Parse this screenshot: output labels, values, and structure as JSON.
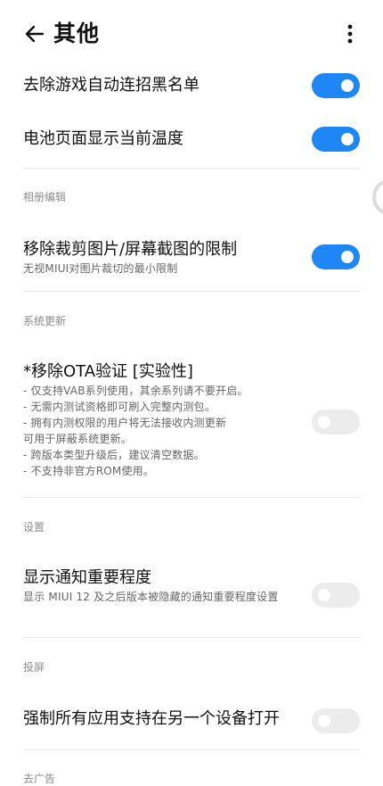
{
  "header": {
    "title": "其他",
    "back_icon": "arrow-left-icon",
    "more_icon": "more-vertical-icon"
  },
  "accent_color": "#1f86f5",
  "sections": {
    "game": {
      "items": [
        {
          "title": "去除游戏自动连招黑名单",
          "enabled": true
        },
        {
          "title": "电池页面显示当前温度",
          "enabled": true
        }
      ]
    },
    "album": {
      "label": "相册编辑",
      "items": [
        {
          "title": "移除裁剪图片/屏幕截图的限制",
          "desc": "无视MIUI对图片裁切的最小限制",
          "enabled": true
        }
      ]
    },
    "system_update": {
      "label": "系统更新",
      "items": [
        {
          "title": "*移除OTA验证 [实验性]",
          "desc": "- 仅支持VAB系列使用，其余系列请不要开启。\n- 无需内测试资格即可刷入完整内测包。\n- 拥有内测权限的用户将无法接收内测更新\n可用于屏蔽系统更新。\n- 跨版本类型升级后，建议清空数据。\n- 不支持非官方ROM使用。",
          "enabled": false
        }
      ]
    },
    "settings": {
      "label": "设置",
      "items": [
        {
          "title": "显示通知重要程度",
          "desc": "显示 MIUI 12 及之后版本被隐藏的通知重要程度设置",
          "enabled": false
        }
      ]
    },
    "cast": {
      "label": "投屏",
      "items": [
        {
          "title": "强制所有应用支持在另一个设备打开",
          "enabled": false
        }
      ]
    },
    "ads": {
      "label": "去广告"
    }
  }
}
